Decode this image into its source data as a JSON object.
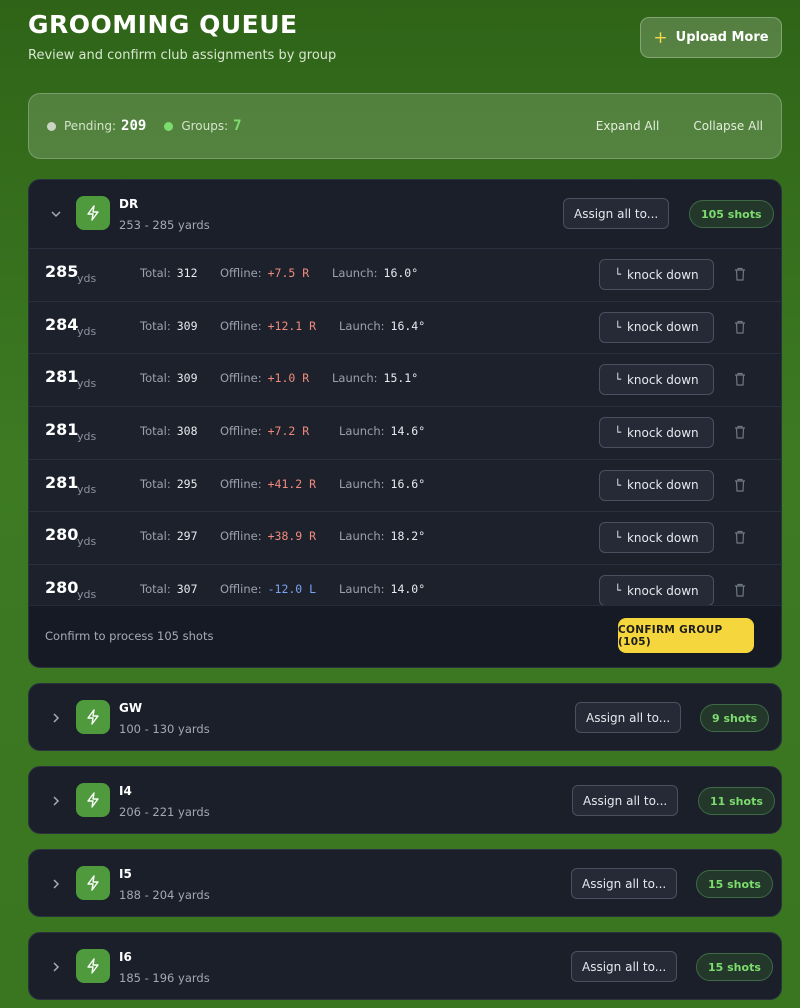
{
  "header": {
    "title": "GROOMING QUEUE",
    "subtitle": "Review and confirm club assignments by group",
    "upload_label": "Upload More"
  },
  "stats": {
    "pending_label": "Pending:",
    "pending_value": "209",
    "groups_label": "Groups:",
    "groups_value": "7",
    "expand_all": "Expand All",
    "collapse_all": "Collapse All"
  },
  "groups": [
    {
      "club": "DR",
      "range": "253 - 285 yards",
      "assign_label": "Assign all to...",
      "shots": "105 shots",
      "expanded": true,
      "shots_list": [
        {
          "yds": "285",
          "unit": "yds",
          "total": "312",
          "offline": "+7.5 R",
          "launch": "16.0°",
          "action": "knock down"
        },
        {
          "yds": "284",
          "unit": "yds",
          "total": "309",
          "offline": "+12.1 R",
          "launch": "16.4°",
          "action": "knock down"
        },
        {
          "yds": "281",
          "unit": "yds",
          "total": "309",
          "offline": "+1.0 R",
          "launch": "15.1°",
          "action": "knock down"
        },
        {
          "yds": "281",
          "unit": "yds",
          "total": "308",
          "offline": "+7.2 R",
          "launch": "14.6°",
          "action": "knock down"
        },
        {
          "yds": "281",
          "unit": "yds",
          "total": "295",
          "offline": "+41.2 R",
          "launch": "16.6°",
          "action": "knock down"
        },
        {
          "yds": "280",
          "unit": "yds",
          "total": "297",
          "offline": "+38.9 R",
          "launch": "18.2°",
          "action": "knock down"
        },
        {
          "yds": "280",
          "unit": "yds",
          "total": "307",
          "offline": "-12.0 L",
          "launch": "14.0°",
          "action": "knock down"
        }
      ],
      "footer_text": "Confirm to process 105 shots",
      "confirm_label": "CONFIRM GROUP (105)"
    },
    {
      "club": "GW",
      "range": "100 - 130 yards",
      "assign_label": "Assign all to...",
      "shots": "9 shots"
    },
    {
      "club": "I4",
      "range": "206 - 221 yards",
      "assign_label": "Assign all to...",
      "shots": "11 shots"
    },
    {
      "club": "I5",
      "range": "188 - 204 yards",
      "assign_label": "Assign all to...",
      "shots": "15 shots"
    },
    {
      "club": "I6",
      "range": "185 - 196 yards",
      "assign_label": "Assign all to...",
      "shots": "15 shots"
    }
  ],
  "labels": {
    "total": "Total:",
    "offline": "Offline:",
    "launch": "Launch:"
  },
  "icons": {
    "expanded_chevron": "chevron-down-icon",
    "collapsed_chevron": "chevron-right-icon",
    "club": "lightning-icon",
    "delete": "trash-icon",
    "knock_down": "corner-arrow-icon",
    "upload": "plus-icon"
  },
  "colors": {
    "accent_green": "#7ddc6e",
    "confirm_yellow": "#f5d73d",
    "offline_right": "#f08a7c",
    "offline_left": "#7aa3f0"
  }
}
